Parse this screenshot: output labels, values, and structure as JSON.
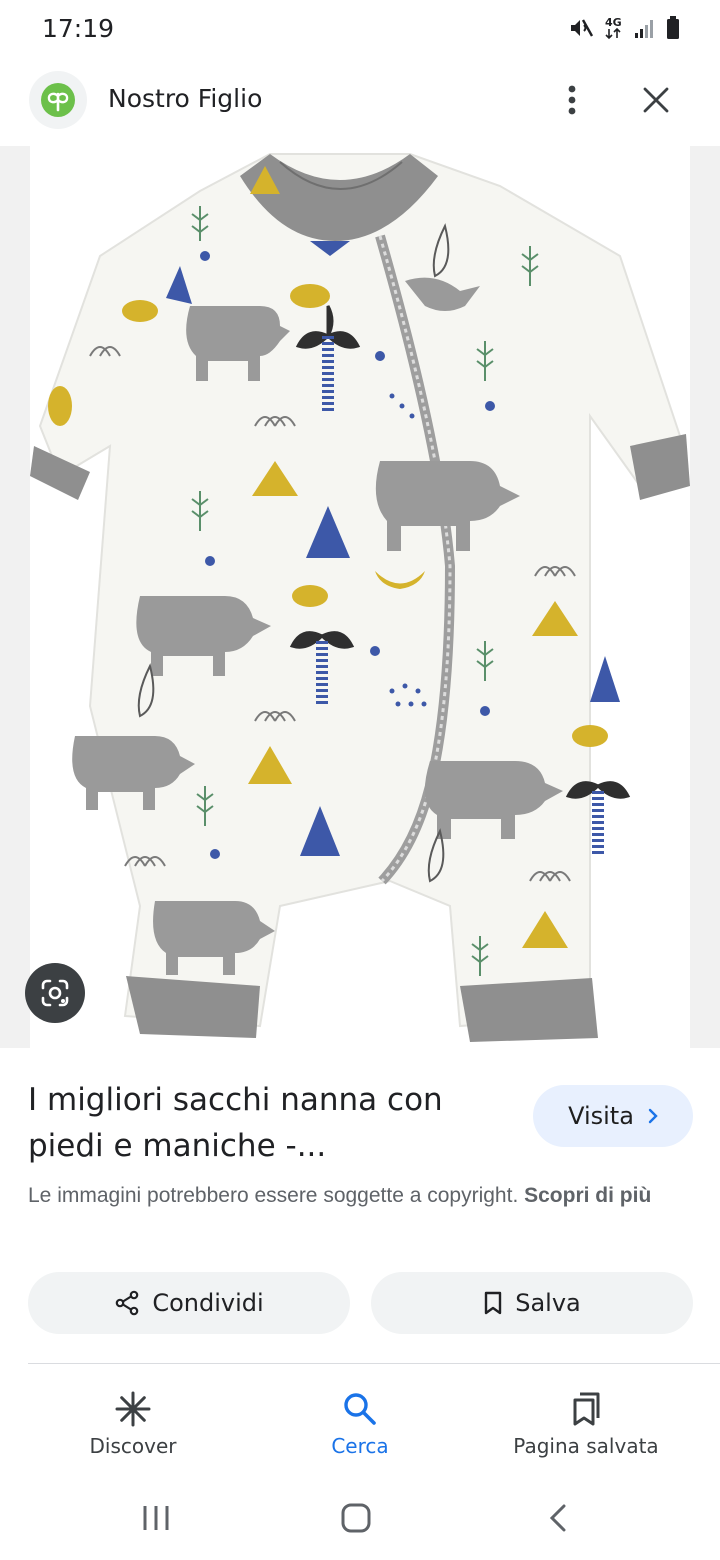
{
  "status_bar": {
    "time": "17:19",
    "icons": [
      "mute-icon",
      "network-4g-icon",
      "signal-icon",
      "battery-icon"
    ],
    "network_label": "4G"
  },
  "header": {
    "site_name": "Nostro Figlio",
    "logo_icon": "nostro-figlio-logo-icon",
    "logo_color": "#6cc04a",
    "more_icon": "more-vert-icon",
    "close_icon": "close-icon"
  },
  "image": {
    "subject": "baby sleeping bag with feet and sleeves",
    "lens_icon": "google-lens-icon"
  },
  "result": {
    "title": "I migliori sacchi nanna con piedi e maniche -...",
    "visit_label": "Visita",
    "copyright_text": "Le immagini potrebbero essere soggette a copyright.",
    "learn_more": "Scopri di più"
  },
  "actions": {
    "share_label": "Condividi",
    "save_label": "Salva"
  },
  "bottom_nav": {
    "items": [
      {
        "label": "Discover",
        "icon": "discover-icon",
        "active": false
      },
      {
        "label": "Cerca",
        "icon": "search-icon",
        "active": true
      },
      {
        "label": "Pagina salvata",
        "icon": "saved-pages-icon",
        "active": false
      }
    ]
  },
  "colors": {
    "accent": "#1a73e8",
    "visit_bg": "#e8f0fe",
    "chip_bg": "#f1f3f4"
  }
}
